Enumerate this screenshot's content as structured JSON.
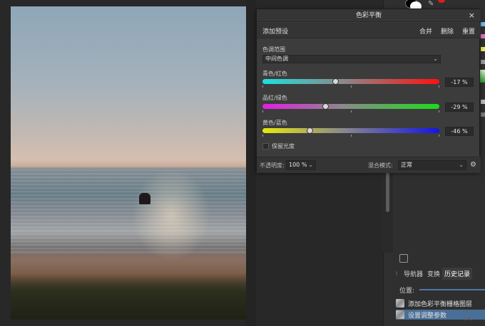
{
  "dialog": {
    "title": "色彩平衡",
    "close_icon": "×",
    "toolbar": {
      "add_preset": "添加预设",
      "merge": "合并",
      "delete": "删除",
      "reset": "重置"
    },
    "tone_range_label": "色调范围",
    "tone_range_value": "中间色调",
    "sliders": [
      {
        "label": "青色/红色",
        "value": -17,
        "display": "-17 %"
      },
      {
        "label": "品红/绿色",
        "value": -29,
        "display": "-29 %"
      },
      {
        "label": "黄色/蓝色",
        "value": -46,
        "display": "-46 %"
      }
    ],
    "preserve_luminosity": "保留光度",
    "footer": {
      "opacity_label": "不透明度:",
      "opacity_value": "100 %",
      "blend_label": "混合模式:",
      "blend_value": "正常"
    }
  },
  "right_panel": {
    "tabs": [
      "导航器",
      "变换",
      "历史记录"
    ],
    "active_tab": "历史记录",
    "position_label": "位置:",
    "history": [
      {
        "label": "添加色彩平衡栅格图层"
      },
      {
        "label": "设置调整参数",
        "selected": true
      }
    ]
  },
  "colors": {
    "accent": "#4a6f97",
    "swatch_blue": "#6fb6e8",
    "swatch_pink": "#e070c0",
    "swatch_yellow": "#e8e860",
    "swatch_red": "#e31b1b"
  }
}
